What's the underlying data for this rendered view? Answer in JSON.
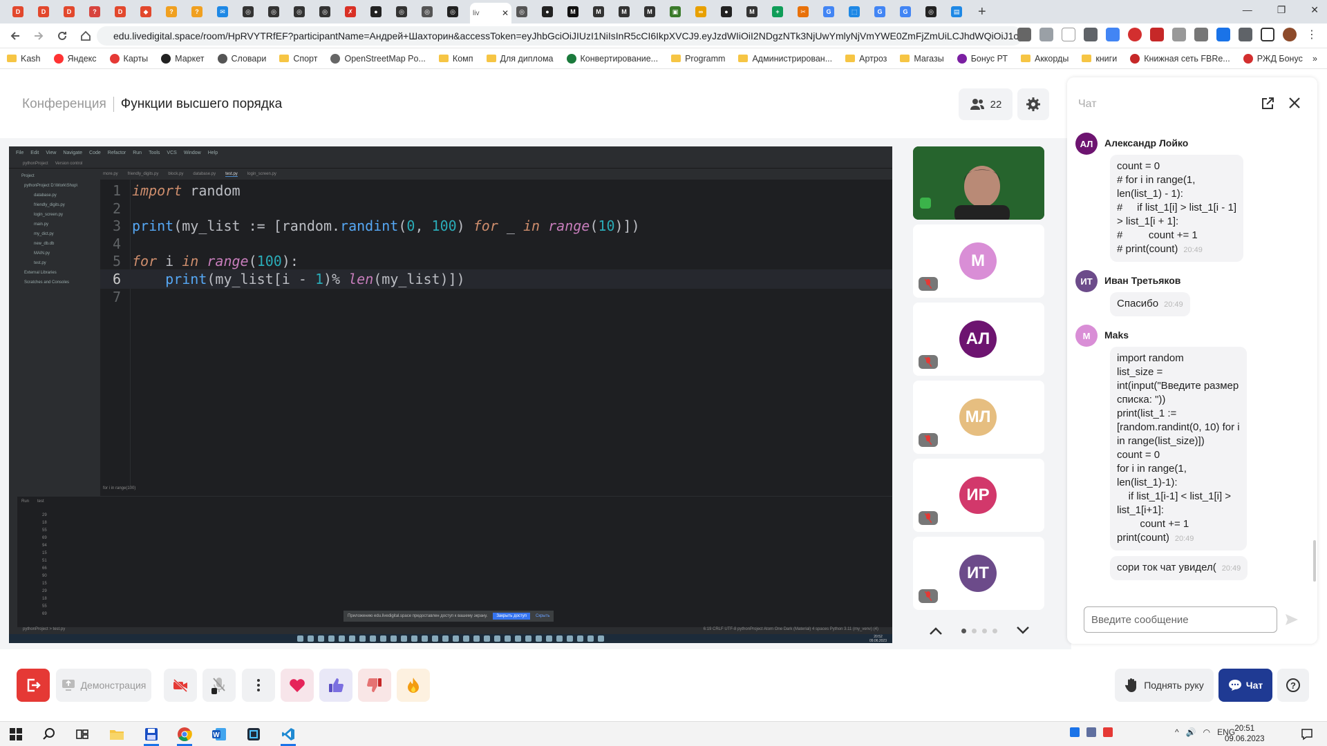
{
  "browser": {
    "tabs": [
      {
        "letter": "D",
        "color": "#e2482d"
      },
      {
        "letter": "D",
        "color": "#e2482d"
      },
      {
        "letter": "D",
        "color": "#e2482d"
      },
      {
        "letter": "?",
        "color": "#d7443e"
      },
      {
        "letter": "D",
        "color": "#e2482d"
      },
      {
        "letter": "◆",
        "color": "#e2482d"
      },
      {
        "letter": "?",
        "color": "#f0a020"
      },
      {
        "letter": "?",
        "color": "#f0a020"
      },
      {
        "letter": "✉",
        "color": "#1e88e5"
      },
      {
        "letter": "◎",
        "color": "#333333"
      },
      {
        "letter": "◎",
        "color": "#333333"
      },
      {
        "letter": "◎",
        "color": "#333333"
      },
      {
        "letter": "◎",
        "color": "#333333"
      },
      {
        "letter": "✗",
        "color": "#d93025"
      },
      {
        "letter": "●",
        "color": "#222222"
      },
      {
        "letter": "◎",
        "color": "#333333"
      },
      {
        "letter": "◎",
        "color": "#555555"
      },
      {
        "letter": "◎",
        "color": "#222222"
      }
    ],
    "active_tab": {
      "label": "liv",
      "close": "✕"
    },
    "tabs_after": [
      {
        "letter": "◎",
        "color": "#555555"
      },
      {
        "letter": "●",
        "color": "#222222"
      },
      {
        "letter": "M",
        "color": "#111111"
      },
      {
        "letter": "M",
        "color": "#333333"
      },
      {
        "letter": "M",
        "color": "#333333"
      },
      {
        "letter": "M",
        "color": "#333333"
      },
      {
        "letter": "▣",
        "color": "#3a7a2a"
      },
      {
        "letter": "∞",
        "color": "#e8a000"
      },
      {
        "letter": "●",
        "color": "#222222"
      },
      {
        "letter": "M",
        "color": "#333333"
      },
      {
        "letter": "+",
        "color": "#0f9d58"
      },
      {
        "letter": "✂",
        "color": "#e8710a"
      },
      {
        "letter": "G",
        "color": "#4285f4"
      },
      {
        "letter": "⬚",
        "color": "#1e88e5"
      },
      {
        "letter": "G",
        "color": "#4285f4"
      },
      {
        "letter": "G",
        "color": "#4285f4"
      },
      {
        "letter": "◎",
        "color": "#222222"
      },
      {
        "letter": "▤",
        "color": "#1e88e5"
      }
    ],
    "url": "edu.livedigital.space/room/HpRVYTRfEF?participantName=Андрей+Шахторин&accessToken=eyJhbGciOiJIUzI1NiIsInR5cCI6IkpXVCJ9.eyJzdWIiOiI2NDgzNTk3NjUwYmlyNjVmYWE0ZmFjZmUiLCJhdWQiOiJ1c...",
    "bookmarks": [
      {
        "label": "Kash",
        "type": "folder"
      },
      {
        "label": "Яндекс",
        "type": "icon",
        "color": "#ff3333"
      },
      {
        "label": "Карты",
        "type": "icon",
        "color": "#e53935"
      },
      {
        "label": "Маркет",
        "type": "icon",
        "color": "#222222"
      },
      {
        "label": "Словари",
        "type": "icon",
        "color": "#555555"
      },
      {
        "label": "Спорт",
        "type": "folder"
      },
      {
        "label": "OpenStreetMap Po...",
        "type": "icon",
        "color": "#666666"
      },
      {
        "label": "Комп",
        "type": "folder"
      },
      {
        "label": "Для диплома",
        "type": "folder"
      },
      {
        "label": "Конвертирование...",
        "type": "icon",
        "color": "#1b7a3c"
      },
      {
        "label": "Programm",
        "type": "folder"
      },
      {
        "label": "Администрирован...",
        "type": "folder"
      },
      {
        "label": "Артроз",
        "type": "folder"
      },
      {
        "label": "Магазы",
        "type": "folder"
      },
      {
        "label": "Бонус РТ",
        "type": "icon",
        "color": "#7b1fa2"
      },
      {
        "label": "Аккорды",
        "type": "folder"
      },
      {
        "label": "книги",
        "type": "folder"
      },
      {
        "label": "Книжная сеть FBRe...",
        "type": "icon",
        "color": "#c62828"
      },
      {
        "label": "РЖД Бонус",
        "type": "icon",
        "color": "#d32f2f"
      }
    ],
    "more": "»"
  },
  "header": {
    "breadcrumb_parent": "Конференция",
    "title": "Функции высшего порядка",
    "participants_count": "22"
  },
  "ide": {
    "menu": [
      "File",
      "Edit",
      "View",
      "Navigate",
      "Code",
      "Refactor",
      "Run",
      "Tools",
      "VCS",
      "Window",
      "Help"
    ],
    "project_name": "pythonProject",
    "vcs": "Version control",
    "tabs": [
      "more.py",
      "friendly_digits.py",
      "block.py",
      "database.py",
      "test.py",
      "login_screen.py"
    ],
    "active_tab": "test.py",
    "project_tree": [
      "Project",
      "pythonProject  D:\\Work\\Shop\\",
      "database.py",
      "friendly_digits.py",
      "login_screen.py",
      "main.py",
      "my_dict.py",
      "new_db.db",
      "MAIN.py",
      "test.py",
      "External Libraries",
      "Scratches and Consoles"
    ],
    "code": [
      {
        "n": "1",
        "tokens": [
          {
            "t": "import",
            "c": "kw"
          },
          {
            "t": " random",
            "c": "nm"
          }
        ]
      },
      {
        "n": "2",
        "tokens": []
      },
      {
        "n": "3",
        "tokens": [
          {
            "t": "print",
            "c": "fn"
          },
          {
            "t": "(my_list := [random.",
            "c": "nm"
          },
          {
            "t": "randint",
            "c": "fn"
          },
          {
            "t": "(",
            "c": "nm"
          },
          {
            "t": "0",
            "c": "num"
          },
          {
            "t": ", ",
            "c": "nm"
          },
          {
            "t": "100",
            "c": "num"
          },
          {
            "t": ") ",
            "c": "nm"
          },
          {
            "t": "for",
            "c": "kw"
          },
          {
            "t": " _ ",
            "c": "nm"
          },
          {
            "t": "in",
            "c": "kw"
          },
          {
            "t": " ",
            "c": "nm"
          },
          {
            "t": "range",
            "c": "bi"
          },
          {
            "t": "(",
            "c": "nm"
          },
          {
            "t": "10",
            "c": "num"
          },
          {
            "t": ")])",
            "c": "nm"
          }
        ]
      },
      {
        "n": "4",
        "tokens": []
      },
      {
        "n": "5",
        "tokens": [
          {
            "t": "for",
            "c": "kw"
          },
          {
            "t": " i ",
            "c": "nm"
          },
          {
            "t": "in",
            "c": "kw"
          },
          {
            "t": " ",
            "c": "nm"
          },
          {
            "t": "range",
            "c": "bi"
          },
          {
            "t": "(",
            "c": "nm"
          },
          {
            "t": "100",
            "c": "num"
          },
          {
            "t": "):",
            "c": "nm"
          }
        ]
      },
      {
        "n": "6",
        "tokens": [
          {
            "t": "    ",
            "c": "nm"
          },
          {
            "t": "print",
            "c": "fn"
          },
          {
            "t": "(my_list[i - ",
            "c": "nm"
          },
          {
            "t": "1",
            "c": "num"
          },
          {
            "t": ")% ",
            "c": "nm"
          },
          {
            "t": "len",
            "c": "bi"
          },
          {
            "t": "(my_list)])",
            "c": "nm"
          }
        ]
      },
      {
        "n": "7",
        "tokens": []
      }
    ],
    "hint": "for i in range(100)",
    "run_tab": "Run",
    "run_config": "test",
    "run_output": [
      "29",
      "18",
      "55",
      "69",
      "94",
      "15",
      "51",
      "66",
      "90",
      "15",
      "29",
      "18",
      "55",
      "69"
    ],
    "notice_text": "Приложению edu.livedigital.space предоставлен доступ к вашему экрану.",
    "notice_button": "Закрыть доступ",
    "notice_link": "Скрыть",
    "status_right": "6:19   CRLF   UTF-8   pythonProject   Atom One Dark (Material)   4 spaces   Python 3.11 (my_venv) (4)",
    "breadcrumb_bottom": "pythonProject  >  test.py",
    "win_time": "20:52",
    "win_date": "09.06.2023"
  },
  "videos": [
    {
      "kind": "camera"
    },
    {
      "initials": "М",
      "color": "#d98ed6"
    },
    {
      "initials": "АЛ",
      "color": "#6d1470"
    },
    {
      "initials": "МЛ",
      "color": "#e6be80"
    },
    {
      "initials": "ИР",
      "color": "#d2386b"
    },
    {
      "initials": "ИТ",
      "color": "#6c4b8a"
    }
  ],
  "chat": {
    "title": "Чат",
    "messages": [
      {
        "initials": "АЛ",
        "color": "#6d1470",
        "name": "Александр Лойко",
        "text": "count = 0\n# for i in range(1,\nlen(list_1) - 1):\n#     if list_1[i] > list_1[i - 1]\n> list_1[i + 1]:\n#         count += 1\n# print(count)",
        "time": "20:49"
      },
      {
        "initials": "ИТ",
        "color": "#6c4b8a",
        "name": "Иван Третьяков",
        "text": "Спасибо",
        "time": "20:49"
      },
      {
        "initials": "М",
        "color": "#d98ed6",
        "name": "Maks",
        "text": "import random\nlist_size =\nint(input(\"Введите размер\nсписка: \"))\nprint(list_1 :=\n[random.randint(0, 10) for i\nin range(list_size)])\ncount = 0\nfor i in range(1,\nlen(list_1)-1):\n    if list_1[i-1] < list_1[i] >\nlist_1[i+1]:\n        count += 1\nprint(count)",
        "time": "20:49"
      },
      {
        "initials": "",
        "color": "#ffffff",
        "name": "",
        "text": "сори ток чат увидел(",
        "time": "20:49"
      }
    ],
    "input_placeholder": "Введите сообщение"
  },
  "controls": {
    "demo_label": "Демонстрация",
    "raise_hand_label": "Поднять руку",
    "chat_label": "Чат",
    "help_label": "?"
  },
  "taskbar": {
    "time": "20:51",
    "date": "09.06.2023",
    "lang": "ENG"
  },
  "colors": {
    "accent_blue": "#1f3a93",
    "leave_red": "#e53935"
  }
}
